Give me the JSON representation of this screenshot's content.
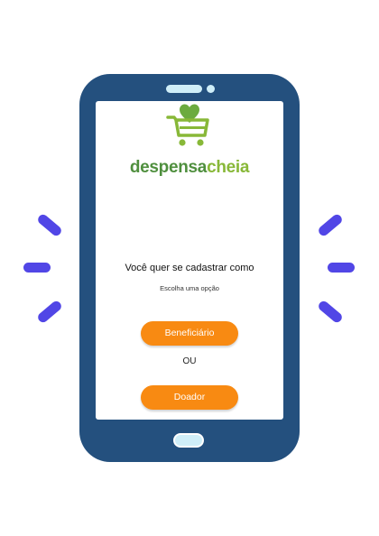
{
  "app": {
    "brand_part1": "despensa",
    "brand_part2": "cheia"
  },
  "signup": {
    "title": "Você quer se cadastrar como",
    "subtitle": "Escolha uma opção",
    "beneficiary_button": "Beneficiário",
    "separator": "OU",
    "donor_button": "Doador"
  },
  "colors": {
    "phone_body": "#24507e",
    "accent_button": "#f88a12",
    "brand_dark_green": "#4f8f3e",
    "brand_light_green": "#88b838",
    "highlight_rays": "#5146e6"
  },
  "icons": {
    "logo": "shopping-cart-with-heart-icon"
  }
}
